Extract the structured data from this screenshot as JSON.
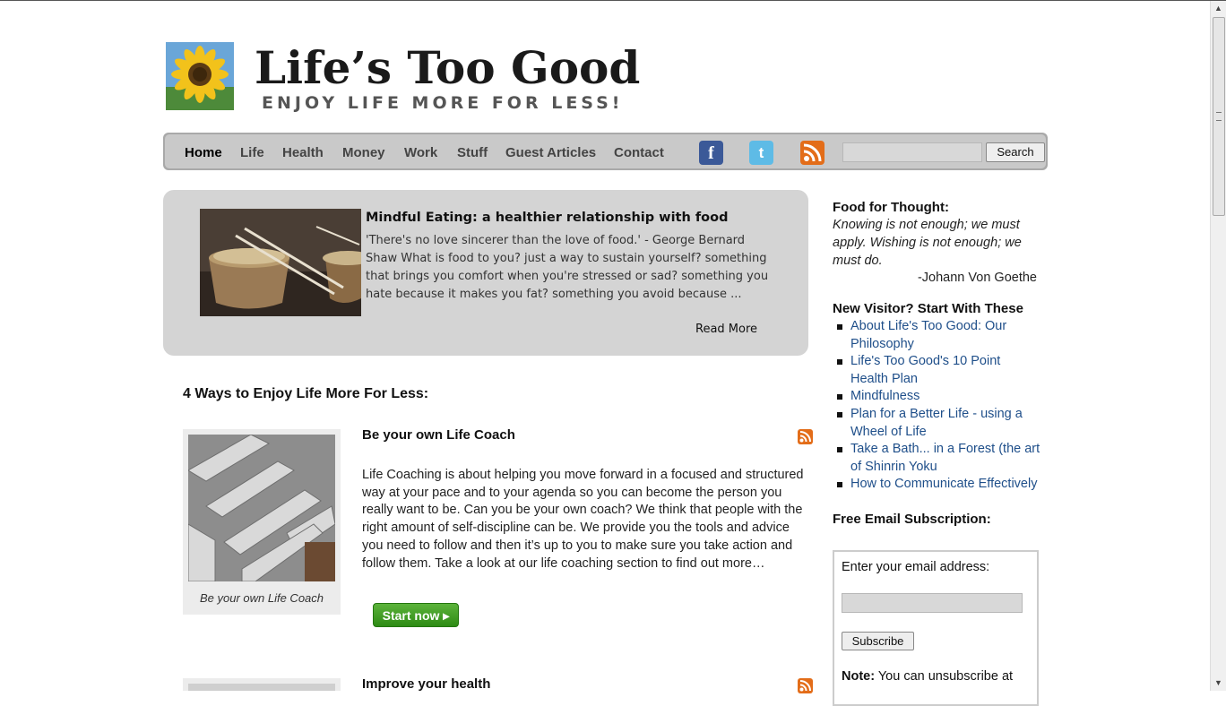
{
  "site": {
    "title": "Life’s Too Good",
    "tagline": "ENJOY LIFE MORE FOR LESS!"
  },
  "nav": {
    "items": [
      "Home",
      "Life",
      "Health",
      "Money",
      "Work",
      "Stuff",
      "Guest Articles",
      "Contact"
    ],
    "active": "Home",
    "social": [
      {
        "icon": "facebook-icon",
        "glyph": "f",
        "color": "#3b5998"
      },
      {
        "icon": "twitter-icon",
        "glyph": "t",
        "color": "#5ebbe6"
      },
      {
        "icon": "rss-icon",
        "color": "#e36d19"
      }
    ],
    "search_button": "Search"
  },
  "featured": {
    "title": "Mindful Eating: a healthier relationship with food",
    "excerpt": "'There's no love sincerer than the love of food.' - George Bernard Shaw What is food to you? just a way to sustain yourself? something that brings you comfort when you're stressed or sad? something you hate because it makes you fat? something you avoid because ...",
    "read_more": "Read More"
  },
  "main": {
    "heading": "4 Ways to Enjoy Life More For Less:",
    "articles": [
      {
        "title": "Be your own Life Coach",
        "caption": "Be your own Life Coach",
        "body": "Life Coaching is about helping you move forward in a focused and structured way at your pace and to your agenda so you can become the person you really want to be.  Can you be your own coach? We think that people with the right amount of self-discipline can be. We provide you the tools and advice you need to follow and then it’s up to you to make sure you take action and follow them. Take a look at our life coaching section to find out more…",
        "button": "Start now ▸"
      },
      {
        "title": "Improve your health"
      }
    ]
  },
  "sidebar": {
    "quote_heading": "Food for Thought:",
    "quote": "Knowing is not enough; we must apply. Wishing is not enough; we must do.",
    "quote_author": "-Johann Von Goethe",
    "new_visitor_heading": "New Visitor? Start With These",
    "links": [
      "About Life's Too Good: Our Philosophy",
      "Life's Too Good's 10 Point Health Plan",
      "Mindfulness",
      "Plan for a Better Life - using a Wheel of Life",
      "Take a Bath... in a Forest (the art of Shinrin Yoku",
      "How to Communicate Effectively"
    ],
    "email_heading": "Free Email Subscription:",
    "email_label": "Enter your email address:",
    "subscribe_button": "Subscribe",
    "note_label": "Note:",
    "note_text": " You can unsubscribe at"
  },
  "colors": {
    "link": "#1f4f8a",
    "nav_bg": "#c9c9c9",
    "featured_bg": "#d4d4d4",
    "rss": "#e36d19",
    "button_green": "#3a9c1e"
  }
}
